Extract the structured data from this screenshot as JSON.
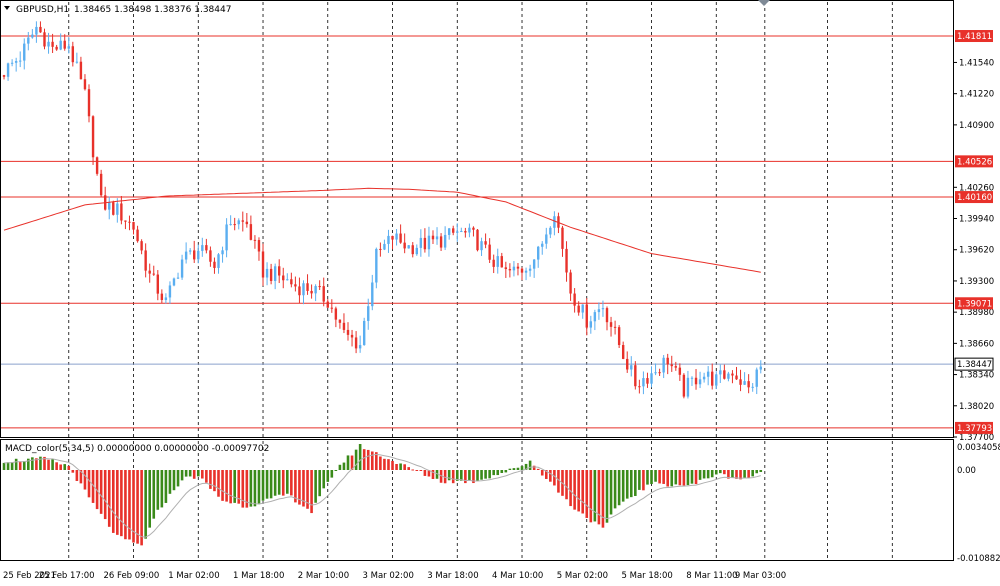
{
  "header": {
    "symbol": "GBPUSD,H1",
    "ohlc": "1.38465 1.38498 1.38376 1.38447"
  },
  "macd": {
    "label": "MACD_color(5,34,5) 0.00000000 0.00000000 -0.00097702",
    "ticks": [
      "0.0034058",
      "0.00",
      "-0.0108820"
    ]
  },
  "colors": {
    "bull": "#5aaef0",
    "bear": "#e8312a",
    "level": "#e8312a",
    "ma": "#e8312a",
    "current_line": "#8aa0cc",
    "macd_up": "#3a8a1a",
    "macd_down": "#e8312a",
    "signal": "#b0b0b0",
    "grid": "#000000"
  },
  "chart_data": {
    "type": "candlestick",
    "symbol": "GBPUSD",
    "timeframe": "H1",
    "ylim": [
      1.377,
      1.4217
    ],
    "y_ticks": [
      "1.41540",
      "1.41220",
      "1.40900",
      "1.40260",
      "1.39940",
      "1.39620",
      "1.39300",
      "1.38980",
      "1.38660",
      "1.38340",
      "1.38020",
      "1.37700"
    ],
    "x_ticks": [
      "25 Feb 2021",
      "25 Feb 17:00",
      "26 Feb 09:00",
      "1 Mar 02:00",
      "1 Mar 18:00",
      "2 Mar 10:00",
      "3 Mar 02:00",
      "3 Mar 18:00",
      "4 Mar 10:00",
      "5 Mar 02:00",
      "5 Mar 18:00",
      "8 Mar 11:00",
      "9 Mar 03:00"
    ],
    "price_levels": [
      {
        "label": "1.41811",
        "value": 1.41811
      },
      {
        "label": "1.40526",
        "value": 1.40526
      },
      {
        "label": "1.40160",
        "value": 1.4016
      },
      {
        "label": "1.39071",
        "value": 1.39071
      },
      {
        "label": "1.37793",
        "value": 1.37793
      }
    ],
    "current_price": {
      "label": "1.38447",
      "value": 1.38447
    },
    "close_path": [
      [
        0,
        1.4145
      ],
      [
        4,
        1.416
      ],
      [
        8,
        1.419
      ],
      [
        12,
        1.4168
      ],
      [
        16,
        1.4172
      ],
      [
        20,
        1.412
      ],
      [
        24,
        1.401
      ],
      [
        28,
        1.4002
      ],
      [
        32,
        1.3985
      ],
      [
        36,
        1.3935
      ],
      [
        40,
        1.3908
      ],
      [
        44,
        1.3952
      ],
      [
        48,
        1.3962
      ],
      [
        52,
        1.3946
      ],
      [
        56,
        1.3992
      ],
      [
        60,
        1.3988
      ],
      [
        64,
        1.394
      ],
      [
        68,
        1.3935
      ],
      [
        72,
        1.3925
      ],
      [
        76,
        1.3922
      ],
      [
        80,
        1.391
      ],
      [
        84,
        1.3875
      ],
      [
        88,
        1.3865
      ],
      [
        92,
        1.3955
      ],
      [
        96,
        1.3975
      ],
      [
        100,
        1.3965
      ],
      [
        104,
        1.3968
      ],
      [
        108,
        1.3972
      ],
      [
        112,
        1.398
      ],
      [
        116,
        1.3975
      ],
      [
        120,
        1.3955
      ],
      [
        124,
        1.3938
      ],
      [
        128,
        1.3942
      ],
      [
        132,
        1.3958
      ],
      [
        136,
        1.4005
      ],
      [
        140,
        1.392
      ],
      [
        144,
        1.389
      ],
      [
        148,
        1.3905
      ],
      [
        152,
        1.3865
      ],
      [
        156,
        1.3825
      ],
      [
        160,
        1.3835
      ],
      [
        164,
        1.385
      ],
      [
        168,
        1.3818
      ],
      [
        172,
        1.3835
      ],
      [
        176,
        1.3828
      ],
      [
        180,
        1.3838
      ],
      [
        184,
        1.3818
      ],
      [
        187,
        1.3842
      ]
    ],
    "ma_path": [
      [
        0,
        1.3982
      ],
      [
        20,
        1.4008
      ],
      [
        40,
        1.4017
      ],
      [
        60,
        1.402
      ],
      [
        80,
        1.4023
      ],
      [
        90,
        1.4025
      ],
      [
        100,
        1.4024
      ],
      [
        112,
        1.4021
      ],
      [
        124,
        1.4011
      ],
      [
        140,
        1.3985
      ],
      [
        160,
        1.3958
      ],
      [
        187,
        1.3939
      ]
    ],
    "macd_path": [
      [
        0,
        0.0012
      ],
      [
        10,
        0.0015
      ],
      [
        16,
        0.0005
      ],
      [
        22,
        -0.0045
      ],
      [
        28,
        -0.0088
      ],
      [
        34,
        -0.01
      ],
      [
        38,
        -0.0055
      ],
      [
        44,
        -0.0012
      ],
      [
        48,
        -0.0008
      ],
      [
        54,
        -0.004
      ],
      [
        60,
        -0.0048
      ],
      [
        70,
        -0.0032
      ],
      [
        76,
        -0.0055
      ],
      [
        82,
        0.0001
      ],
      [
        88,
        0.0032
      ],
      [
        96,
        0.0012
      ],
      [
        108,
        -0.0015
      ],
      [
        116,
        -0.0015
      ],
      [
        126,
        0.0001
      ],
      [
        130,
        0.0012
      ],
      [
        134,
        -0.001
      ],
      [
        140,
        -0.0046
      ],
      [
        148,
        -0.0078
      ],
      [
        152,
        -0.0045
      ],
      [
        160,
        -0.0018
      ],
      [
        170,
        -0.002
      ],
      [
        176,
        -0.0005
      ],
      [
        182,
        -0.0012
      ],
      [
        187,
        -0.0005
      ]
    ]
  }
}
